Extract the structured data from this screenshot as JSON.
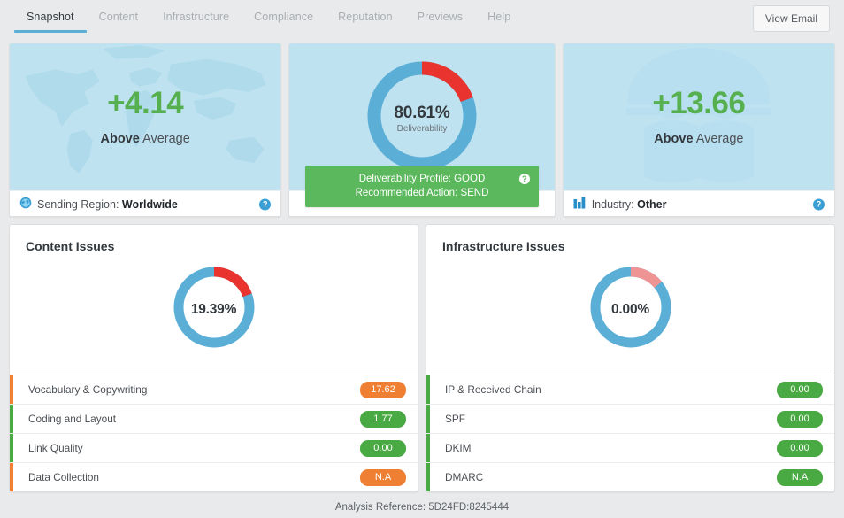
{
  "nav": {
    "tabs": [
      {
        "label": "Snapshot",
        "active": true
      },
      {
        "label": "Content",
        "active": false
      },
      {
        "label": "Infrastructure",
        "active": false
      },
      {
        "label": "Compliance",
        "active": false
      },
      {
        "label": "Reputation",
        "active": false
      },
      {
        "label": "Previews",
        "active": false
      },
      {
        "label": "Help",
        "active": false
      }
    ],
    "view_email_label": "View Email"
  },
  "cards": {
    "region": {
      "score": "+4.14",
      "sub_strong": "Above",
      "sub_rest": " Average",
      "foot_label": "Sending Region: ",
      "foot_value": "Worldwide",
      "icon": "globe-icon",
      "help": "?"
    },
    "deliverability": {
      "value": "80.61%",
      "caption": "Deliverability",
      "percent": 80.61,
      "banner_line1": "Deliverability Profile: GOOD",
      "banner_line2": "Recommended Action: SEND",
      "help": "?"
    },
    "industry": {
      "score": "+13.66",
      "sub_strong": "Above",
      "sub_rest": " Average",
      "foot_label": "Industry: ",
      "foot_value": "Other",
      "icon": "bar-chart-icon",
      "help": "?"
    }
  },
  "panels": [
    {
      "title": "Content Issues",
      "donut_value": "19.39%",
      "donut_percent": 19.39,
      "donut_accent": "#e8332f",
      "rows": [
        {
          "name": "Vocabulary & Copywriting",
          "value": "17.62",
          "color": "#ef8033"
        },
        {
          "name": "Coding and Layout",
          "value": "1.77",
          "color": "#49a942"
        },
        {
          "name": "Link Quality",
          "value": "0.00",
          "color": "#49a942"
        },
        {
          "name": "Data Collection",
          "value": "N.A",
          "color": "#ef8033"
        }
      ]
    },
    {
      "title": "Infrastructure Issues",
      "donut_value": "0.00%",
      "donut_percent": 14.0,
      "donut_accent": "#ee9494",
      "rows": [
        {
          "name": "IP & Received Chain",
          "value": "0.00",
          "color": "#49a942"
        },
        {
          "name": "SPF",
          "value": "0.00",
          "color": "#49a942"
        },
        {
          "name": "DKIM",
          "value": "0.00",
          "color": "#49a942"
        },
        {
          "name": "DMARC",
          "value": "N.A",
          "color": "#49a942"
        }
      ]
    }
  ],
  "footer": {
    "analysis_reference": "Analysis Reference: 5D24FD:8245444"
  },
  "colors": {
    "donut_blue": "#5bafd7",
    "accent_red": "#e8332f",
    "accent_salmon": "#ee9494",
    "green": "#5cb85c",
    "orange": "#ef8033",
    "score_green": "#56b050",
    "card_blue_bg": "#bfe2f0",
    "tab_underline": "#5bafd7"
  }
}
